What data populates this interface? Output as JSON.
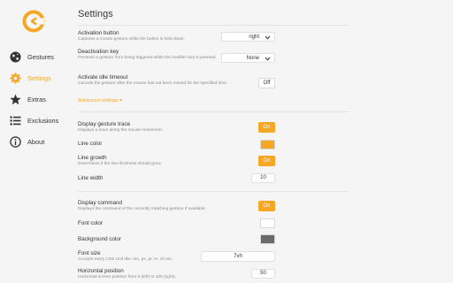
{
  "sidebar": {
    "items": [
      {
        "label": "Gestures",
        "icon": "globe-icon"
      },
      {
        "label": "Settings",
        "icon": "gear-icon",
        "active": true
      },
      {
        "label": "Extras",
        "icon": "star-icon"
      },
      {
        "label": "Exclusions",
        "icon": "list-icon"
      },
      {
        "label": "About",
        "icon": "info-icon"
      }
    ]
  },
  "main": {
    "title": "Settings",
    "activation": {
      "label": "Activation button",
      "desc": "Captures a mouse gesture while the button is held down.",
      "value": "right"
    },
    "deactivation": {
      "label": "Deactivation key",
      "desc": "Prevents a gesture from being triggered while the modifier key is pressed.",
      "value": "None"
    },
    "idle_timeout": {
      "label": "Activate idle timeout",
      "desc": "Cancels the gesture after the mouse has not been moved for the specified time.",
      "value": "Off"
    },
    "advanced_link": "Advanced settings ▾",
    "gesture_trace": {
      "label": "Display gesture trace",
      "desc": "Displays a trace along the mouse movement.",
      "value": "On"
    },
    "line_color": {
      "label": "Line color",
      "color": "#f6a724"
    },
    "line_growth": {
      "label": "Line growth",
      "desc": "Determines if the line thickness should grow.",
      "value": "On"
    },
    "line_width": {
      "label": "Line width",
      "value": "10"
    },
    "display_command": {
      "label": "Display command",
      "desc": "Displays the command of the currently matching gesture if available.",
      "value": "On"
    },
    "font_color": {
      "label": "Font color",
      "color": "#ffffff"
    },
    "background_color": {
      "label": "Background color",
      "color": "#6b6b6b"
    },
    "font_size": {
      "label": "Font size",
      "desc": "Accepts every CSS Unit like: em, px, pt, %, vh etc.",
      "value": "7vh"
    },
    "horizontal_position": {
      "label": "Horizontal position",
      "desc": "Horizontal screen position from 0 (left) to 100 (right).",
      "value": "50"
    }
  },
  "colors": {
    "accent": "#f6a724",
    "background": "#f5f5f6"
  }
}
